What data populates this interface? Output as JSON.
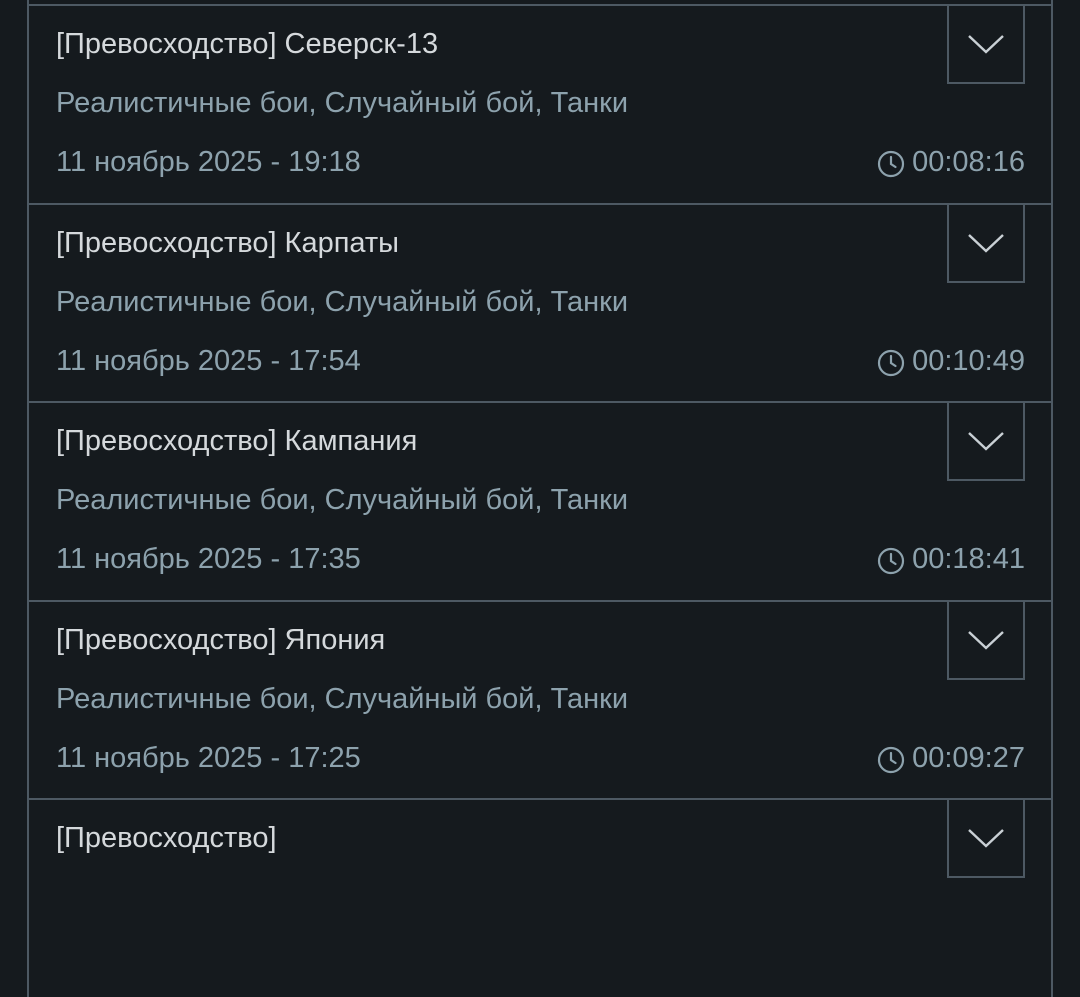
{
  "battles": [
    {
      "title": "[Превосходство] Северск-13",
      "subtitle": "Реалистичные бои, Случайный бой, Танки",
      "date": "11 ноябрь 2025 - 19:18",
      "duration": "00:08:16"
    },
    {
      "title": "[Превосходство] Карпаты",
      "subtitle": "Реалистичные бои, Случайный бой, Танки",
      "date": "11 ноябрь 2025 - 17:54",
      "duration": "00:10:49"
    },
    {
      "title": "[Превосходство] Кампания",
      "subtitle": "Реалистичные бои, Случайный бой, Танки",
      "date": "11 ноябрь 2025 - 17:35",
      "duration": "00:18:41"
    },
    {
      "title": "[Превосходство] Япония",
      "subtitle": "Реалистичные бои, Случайный бой, Танки",
      "date": "11 ноябрь 2025 - 17:25",
      "duration": "00:09:27"
    },
    {
      "title": "[Превосходство]",
      "subtitle": "",
      "date": "",
      "duration": ""
    }
  ],
  "icons": {
    "expand": "chevron-down-icon",
    "duration": "clock-icon"
  },
  "colors": {
    "background": "#151a1e",
    "border": "#4d5963",
    "title_text": "#d5d9dc",
    "secondary_text": "#8da2ad"
  }
}
